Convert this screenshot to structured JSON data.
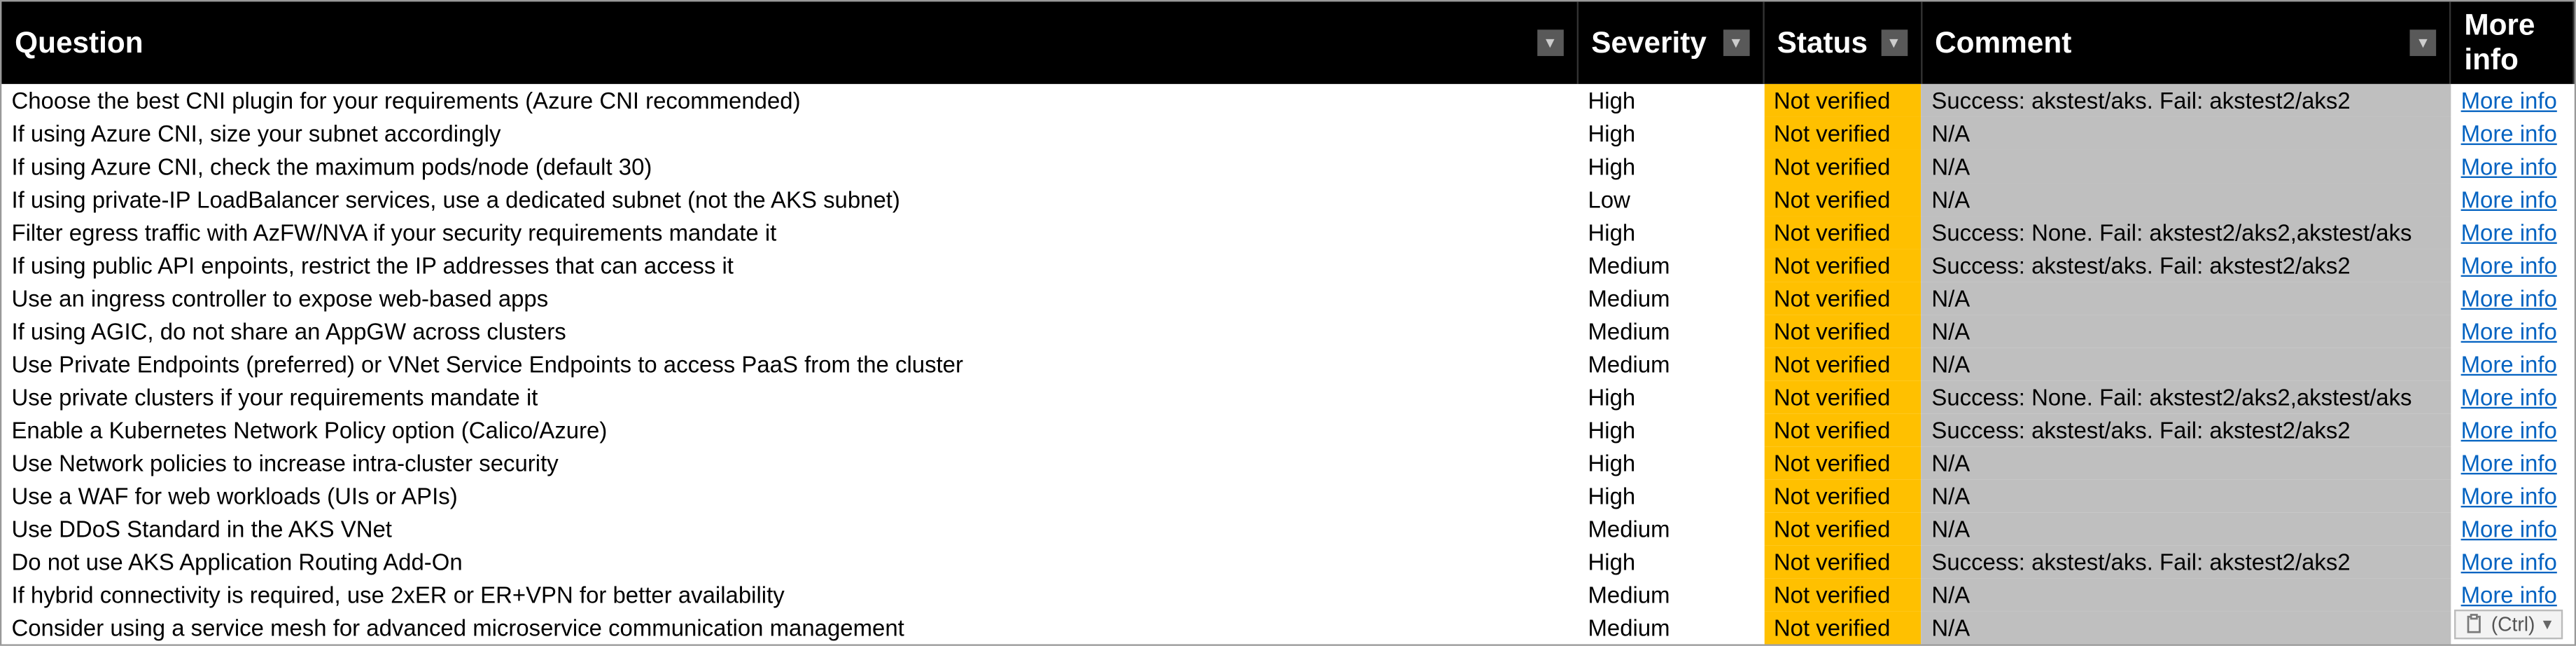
{
  "headers": {
    "question": "Question",
    "severity": "Severity",
    "status": "Status",
    "comment": "Comment",
    "moreinfo": "More info"
  },
  "link_label": "More info",
  "paste_options_label": "(Ctrl)",
  "rows": [
    {
      "question": "Choose the best CNI plugin for your requirements (Azure CNI recommended)",
      "severity": "High",
      "status": "Not verified",
      "comment": "Success: akstest/aks. Fail: akstest2/aks2"
    },
    {
      "question": "If using Azure CNI, size your subnet accordingly",
      "severity": "High",
      "status": "Not verified",
      "comment": "N/A"
    },
    {
      "question": "If using Azure CNI, check the maximum pods/node (default 30)",
      "severity": "High",
      "status": "Not verified",
      "comment": "N/A"
    },
    {
      "question": "If using private-IP LoadBalancer services, use a dedicated subnet (not the AKS subnet)",
      "severity": "Low",
      "status": "Not verified",
      "comment": "N/A"
    },
    {
      "question": "Filter egress traffic with AzFW/NVA if your security requirements mandate it",
      "severity": "High",
      "status": "Not verified",
      "comment": "Success: None. Fail: akstest2/aks2,akstest/aks"
    },
    {
      "question": "If using public API enpoints, restrict the IP addresses that can access it",
      "severity": "Medium",
      "status": "Not verified",
      "comment": "Success: akstest/aks. Fail: akstest2/aks2"
    },
    {
      "question": "Use an ingress controller to expose web-based apps",
      "severity": "Medium",
      "status": "Not verified",
      "comment": "N/A"
    },
    {
      "question": "If using AGIC, do not share an AppGW across clusters",
      "severity": "Medium",
      "status": "Not verified",
      "comment": "N/A"
    },
    {
      "question": "Use Private Endpoints (preferred) or VNet Service Endpoints to access PaaS from the cluster",
      "severity": "Medium",
      "status": "Not verified",
      "comment": "N/A"
    },
    {
      "question": "Use private clusters if your requirements mandate it",
      "severity": "High",
      "status": "Not verified",
      "comment": "Success: None. Fail: akstest2/aks2,akstest/aks"
    },
    {
      "question": "Enable a Kubernetes Network Policy option (Calico/Azure)",
      "severity": "High",
      "status": "Not verified",
      "comment": "Success: akstest/aks. Fail: akstest2/aks2"
    },
    {
      "question": "Use Network policies to increase intra-cluster security",
      "severity": "High",
      "status": "Not verified",
      "comment": "N/A"
    },
    {
      "question": "Use a WAF for web workloads (UIs or APIs)",
      "severity": "High",
      "status": "Not verified",
      "comment": "N/A"
    },
    {
      "question": "Use DDoS Standard in the AKS VNet",
      "severity": "Medium",
      "status": "Not verified",
      "comment": "N/A"
    },
    {
      "question": "Do not use AKS Application Routing Add-On",
      "severity": "High",
      "status": "Not verified",
      "comment": "Success: akstest/aks. Fail: akstest2/aks2"
    },
    {
      "question": "If hybrid connectivity is required, use 2xER or ER+VPN for better availability",
      "severity": "Medium",
      "status": "Not verified",
      "comment": "N/A"
    },
    {
      "question": "Consider using a service mesh for advanced microservice communication management",
      "severity": "Medium",
      "status": "Not verified",
      "comment": "N/A"
    }
  ]
}
